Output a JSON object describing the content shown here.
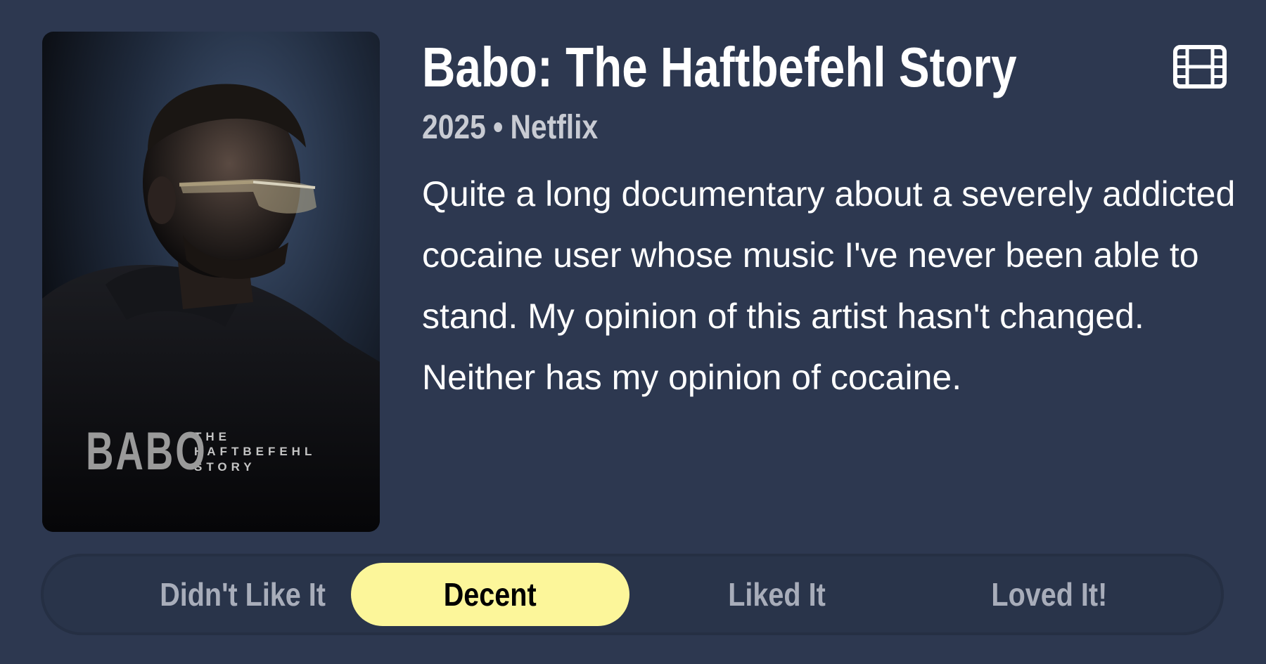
{
  "movie": {
    "title": "Babo: The Haftbefehl Story",
    "year": "2025",
    "separator": "•",
    "service": "Netflix",
    "type_icon": "film-icon",
    "review": "Quite a long documentary about a severely addicted cocaine user whose music I've never been able to stand. My opinion of this artist hasn't changed. Neither has my opinion of cocaine."
  },
  "poster": {
    "title_main": "BABO",
    "title_line1": "THE",
    "title_line2": "HAFTBEFEHL",
    "title_line3": "STORY"
  },
  "rating": {
    "options": [
      "Didn't Like It",
      "Decent",
      "Liked It",
      "Loved It!"
    ],
    "selected": "Decent",
    "selected_color": "#fcf69a"
  },
  "colors": {
    "background": "#2d3850",
    "bar": "#29344a",
    "muted_text": "#a8adba"
  }
}
